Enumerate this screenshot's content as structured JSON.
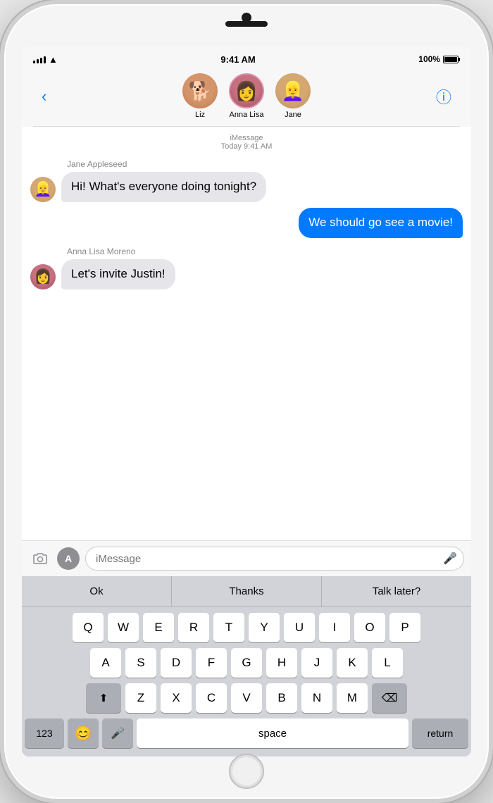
{
  "phone": {
    "status_bar": {
      "time": "9:41 AM",
      "battery_label": "100%"
    },
    "nav": {
      "back_label": "‹",
      "contacts": [
        {
          "name": "Liz",
          "avatar_emoji": "🐶"
        },
        {
          "name": "Anna Lisa",
          "avatar_emoji": "👩"
        },
        {
          "name": "Jane",
          "avatar_emoji": "👱‍♀️"
        }
      ],
      "info_icon": "ⓘ"
    },
    "messages": {
      "timestamp": "iMessage\nToday 9:41 AM",
      "items": [
        {
          "id": "msg1",
          "sender_label": "Jane Appleseed",
          "type": "incoming",
          "text": "Hi! What's everyone doing tonight?",
          "avatar_type": "jane"
        },
        {
          "id": "msg2",
          "sender_label": "",
          "type": "outgoing",
          "text": "We should go see a movie!"
        },
        {
          "id": "msg3",
          "sender_label": "Anna Lisa Moreno",
          "type": "incoming",
          "text": "Let's invite Justin!",
          "avatar_type": "anna"
        }
      ]
    },
    "input_bar": {
      "camera_icon": "📷",
      "appstore_icon": "Ⓐ",
      "placeholder": "iMessage",
      "mic_icon": "🎤"
    },
    "predictive": [
      {
        "label": "Ok"
      },
      {
        "label": "Thanks"
      },
      {
        "label": "Talk later?"
      }
    ],
    "keyboard": {
      "rows": [
        [
          "Q",
          "W",
          "E",
          "R",
          "T",
          "Y",
          "U",
          "I",
          "O",
          "P"
        ],
        [
          "A",
          "S",
          "D",
          "F",
          "G",
          "H",
          "J",
          "K",
          "L"
        ],
        [
          "⬆",
          "Z",
          "X",
          "C",
          "V",
          "B",
          "N",
          "M",
          "⌫"
        ]
      ],
      "bottom_row": [
        "123",
        "😊",
        "🎤",
        "space",
        "return"
      ]
    }
  }
}
